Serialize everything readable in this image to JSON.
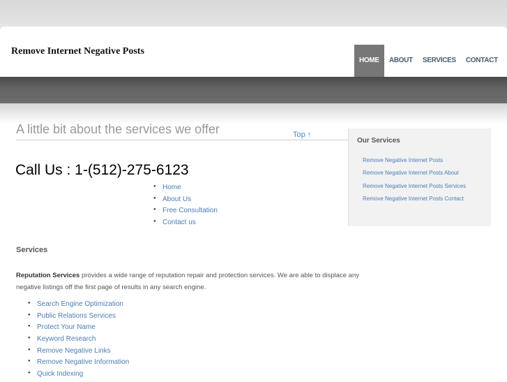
{
  "header": {
    "site_title": "Remove Internet Negative Posts",
    "nav": [
      "HOME",
      "ABOUT",
      "SERVICES",
      "CONTACT"
    ],
    "active_nav": "HOME"
  },
  "main": {
    "tagline": "A little bit about the services we offer",
    "top_link": "Top ↑",
    "call_us": "Call Us : 1-(512)-275-6123",
    "quick_links": [
      "Home",
      "About Us",
      "Free Consultation",
      "Contact us"
    ],
    "services_heading": "Services",
    "description_bold": "Reputation Services",
    "description_rest": " provides a wide range of reputation repair and protection services. We are able to displace any negative listings off the first page of results in any search engine.",
    "service_links": [
      "Search Engine Optimization",
      "Public Relations Services",
      "Protect Your Name",
      "Keyword Research",
      "Remove Negative Links",
      "Remove Negative Information",
      "Quick Indexing"
    ]
  },
  "sidebar": {
    "heading": "Our Services",
    "links": [
      "Remove Negative Internet Posts",
      "Remove Negative Internet Posts About",
      "Remove Negative Internet Posts Services",
      "Remove Negative Internet Posts Contact"
    ]
  },
  "colors": {
    "link": "#4a7db8",
    "nav_active_bg": "#777777",
    "header_band": "#5a5a5a"
  }
}
